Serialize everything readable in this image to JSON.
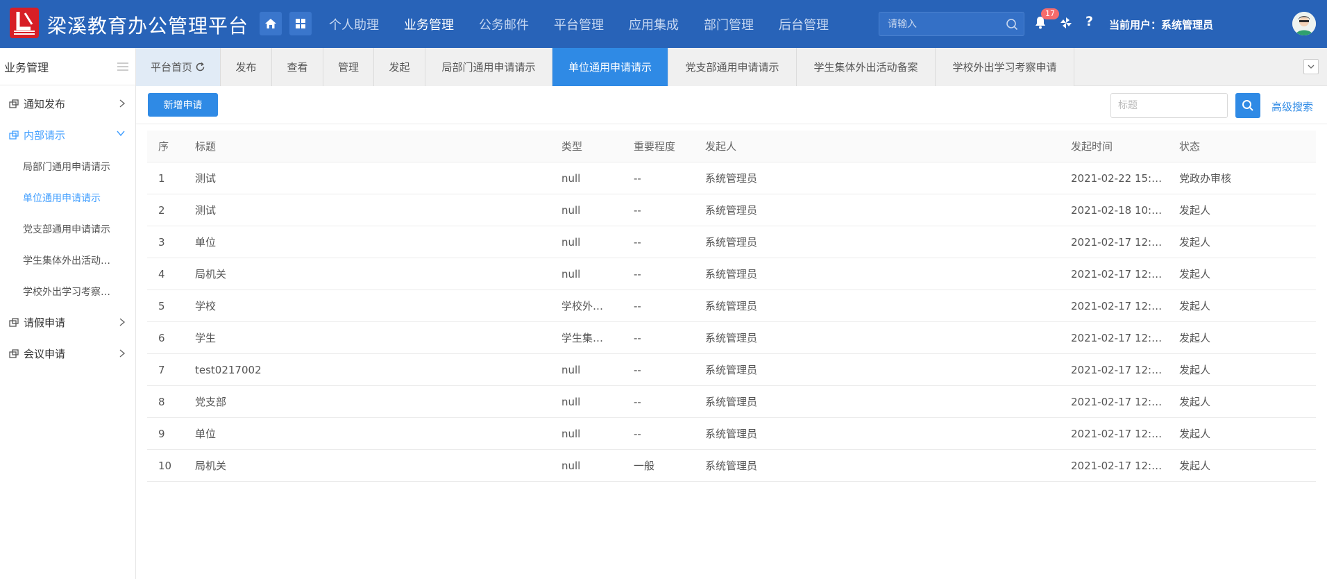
{
  "header": {
    "title": "梁溪教育办公管理平台",
    "nav": [
      "个人助理",
      "业务管理",
      "公务邮件",
      "平台管理",
      "应用集成",
      "部门管理",
      "后台管理"
    ],
    "active_nav": "业务管理",
    "search_placeholder": "请输入",
    "notification_count": "17",
    "help": "?",
    "user_label": "当前用户：系统管理员"
  },
  "sidebar": {
    "title": "业务管理",
    "groups": [
      {
        "label": "通知发布"
      },
      {
        "label": "内部请示",
        "children": [
          "局部门通用申请请示",
          "单位通用申请请示",
          "党支部通用申请请示",
          "学生集体外出活动…",
          "学校外出学习考察…"
        ]
      },
      {
        "label": "请假申请"
      },
      {
        "label": "会议申请"
      }
    ]
  },
  "tabs": [
    "平台首页",
    "发布",
    "查看",
    "管理",
    "发起",
    "局部门通用申请请示",
    "单位通用申请请示",
    "党支部通用申请请示",
    "学生集体外出活动备案",
    "学校外出学习考察申请"
  ],
  "toolbar": {
    "new_button": "新增申请",
    "title_placeholder": "标题",
    "advanced_search": "高级搜索"
  },
  "table": {
    "headers": [
      "序",
      "标题",
      "类型",
      "重要程度",
      "发起人",
      "发起时间",
      "状态"
    ],
    "rows": [
      [
        "1",
        "测试",
        "null",
        "--",
        "系统管理员",
        "2021-02-22 15:…",
        "党政办审核"
      ],
      [
        "2",
        "测试",
        "null",
        "--",
        "系统管理员",
        "2021-02-18 10:…",
        "发起人"
      ],
      [
        "3",
        "单位",
        "null",
        "--",
        "系统管理员",
        "2021-02-17 12:…",
        "发起人"
      ],
      [
        "4",
        "局机关",
        "null",
        "--",
        "系统管理员",
        "2021-02-17 12:…",
        "发起人"
      ],
      [
        "5",
        "学校",
        "学校外…",
        "--",
        "系统管理员",
        "2021-02-17 12:…",
        "发起人"
      ],
      [
        "6",
        "学生",
        "学生集…",
        "--",
        "系统管理员",
        "2021-02-17 12:…",
        "发起人"
      ],
      [
        "7",
        "test0217002",
        "null",
        "--",
        "系统管理员",
        "2021-02-17 12:…",
        "发起人"
      ],
      [
        "8",
        "党支部",
        "null",
        "--",
        "系统管理员",
        "2021-02-17 12:…",
        "发起人"
      ],
      [
        "9",
        "单位",
        "null",
        "--",
        "系统管理员",
        "2021-02-17 12:…",
        "发起人"
      ],
      [
        "10",
        "局机关",
        "null",
        "一般",
        "系统管理员",
        "2021-02-17 12:…",
        "发起人"
      ]
    ]
  },
  "colors": {
    "header_bg": "#2863b8",
    "accent": "#2f8ae5",
    "active_link": "#409eff",
    "badge": "#f56c6c"
  }
}
